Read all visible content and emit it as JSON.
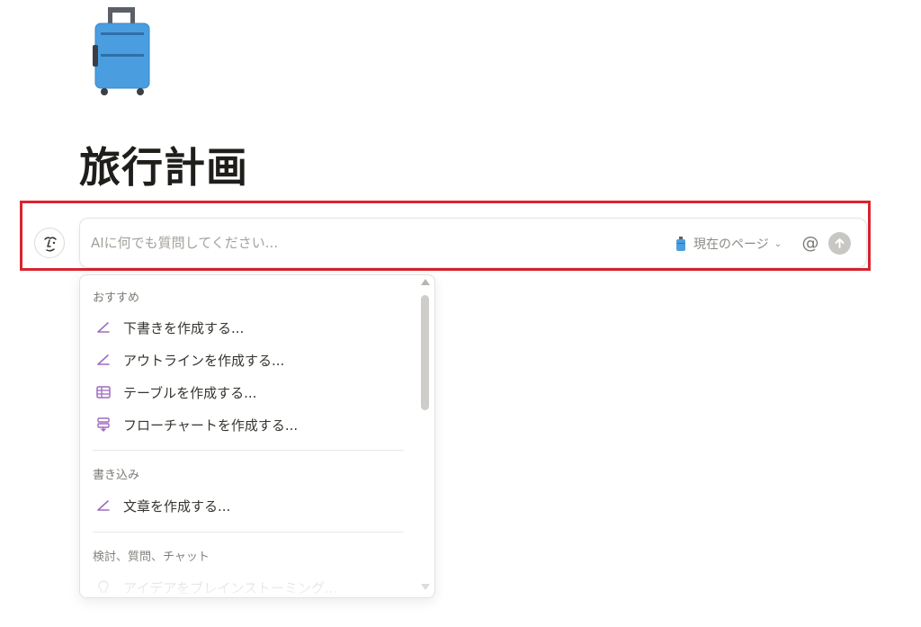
{
  "page": {
    "title": "旅行計画",
    "icon": "suitcase-icon"
  },
  "ai_bar": {
    "placeholder": "AIに何でも質問してください...",
    "context_label": "現在のページ",
    "mention_symbol": "@",
    "icons": {
      "avatar": "ai-face-icon",
      "context": "suitcase-icon",
      "dropdown": "chevron-down-icon",
      "send": "arrow-up-icon"
    }
  },
  "menu": {
    "sections": [
      {
        "header": "おすすめ",
        "items": [
          {
            "label": "下書きを作成する...",
            "icon": "pen-icon"
          },
          {
            "label": "アウトラインを作成する...",
            "icon": "pen-icon"
          },
          {
            "label": "テーブルを作成する...",
            "icon": "table-icon"
          },
          {
            "label": "フローチャートを作成する...",
            "icon": "flowchart-icon"
          }
        ]
      },
      {
        "header": "書き込み",
        "items": [
          {
            "label": "文章を作成する...",
            "icon": "pen-icon"
          }
        ]
      },
      {
        "header": "検討、質問、チャット",
        "items": [
          {
            "label": "アイデアをブレインストーミング...",
            "icon": "lightbulb-icon"
          }
        ]
      }
    ]
  },
  "colors": {
    "highlight": "#d9242f",
    "icon_accent": "#9f6bc0",
    "suitcase_blue": "#4a9ee0"
  }
}
